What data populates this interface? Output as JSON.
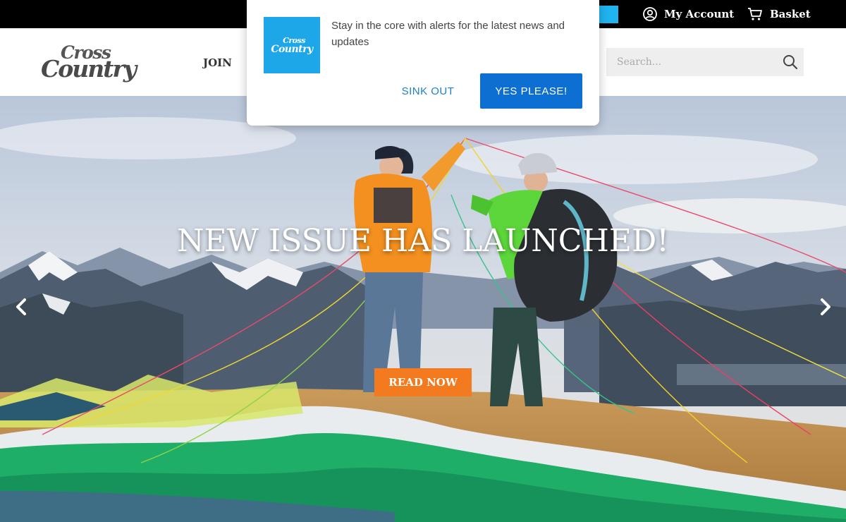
{
  "topbar": {
    "account_label": "My Account",
    "account_icon": "user-circle-icon",
    "basket_label": "Basket",
    "basket_icon": "cart-icon",
    "accent_color": "#1fb3f0"
  },
  "header": {
    "logo_line1": "Cross",
    "logo_line2": "Country",
    "nav": [
      {
        "label": "JOIN"
      }
    ],
    "search_placeholder": "Search...",
    "search_icon": "search-icon"
  },
  "hero": {
    "title": "NEW ISSUE HAS LAUNCHED!",
    "cta_label": "READ NOW",
    "cta_color": "#f47a20",
    "prev_icon": "chevron-left-icon",
    "next_icon": "chevron-right-icon"
  },
  "popup": {
    "logo_line1": "Cross",
    "logo_line2": "Country",
    "message": "Stay in the core with alerts for the latest news and updates",
    "decline_label": "SINK OUT",
    "accept_label": "YES PLEASE!",
    "accept_color": "#0d6fd1"
  }
}
